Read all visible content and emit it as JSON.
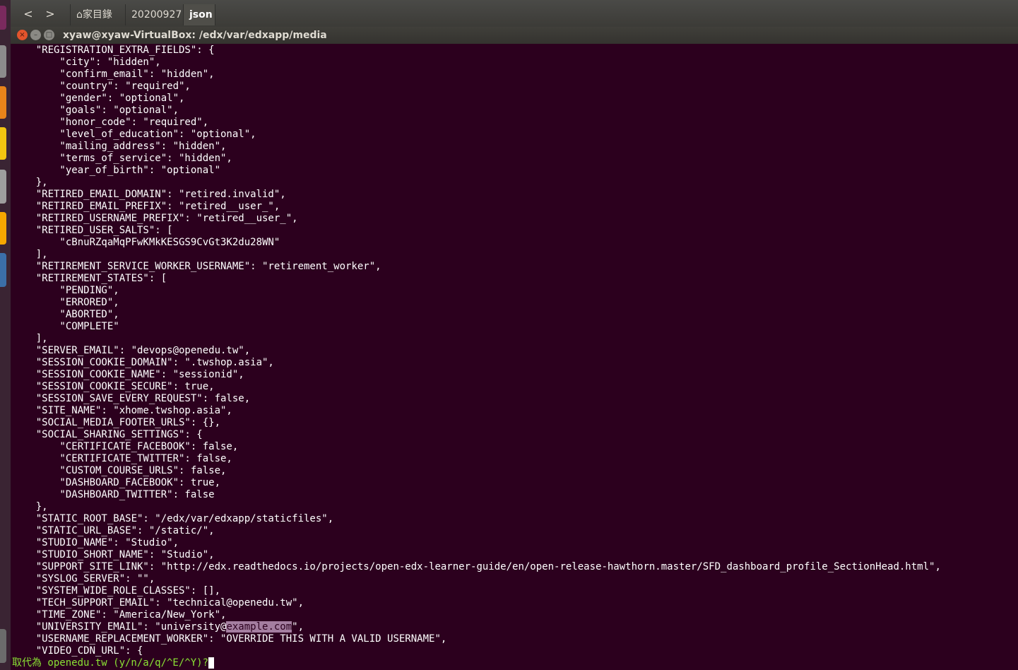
{
  "topbar": {
    "back_label": "<",
    "forward_label": ">",
    "home_label": "家目錄",
    "crumb_1": "20200927",
    "crumb_2": "json"
  },
  "window": {
    "title": "xyaw@xyaw-VirtualBox: /edx/var/edxapp/media",
    "close_label": "×",
    "minimize_label": "–",
    "maximize_label": "□"
  },
  "terminal": {
    "lines": [
      "    \"REGISTRATION_EXTRA_FIELDS\": {",
      "        \"city\": \"hidden\",",
      "        \"confirm_email\": \"hidden\",",
      "        \"country\": \"required\",",
      "        \"gender\": \"optional\",",
      "        \"goals\": \"optional\",",
      "        \"honor_code\": \"required\",",
      "        \"level_of_education\": \"optional\",",
      "        \"mailing_address\": \"hidden\",",
      "        \"terms_of_service\": \"hidden\",",
      "        \"year_of_birth\": \"optional\"",
      "    },",
      "    \"RETIRED_EMAIL_DOMAIN\": \"retired.invalid\",",
      "    \"RETIRED_EMAIL_PREFIX\": \"retired__user_\",",
      "    \"RETIRED_USERNAME_PREFIX\": \"retired__user_\",",
      "    \"RETIRED_USER_SALTS\": [",
      "        \"cBnuRZqaMqPFwKMkKESGS9CvGt3K2du28WN\"",
      "    ],",
      "    \"RETIREMENT_SERVICE_WORKER_USERNAME\": \"retirement_worker\",",
      "    \"RETIREMENT_STATES\": [",
      "        \"PENDING\",",
      "        \"ERRORED\",",
      "        \"ABORTED\",",
      "        \"COMPLETE\"",
      "    ],",
      "    \"SERVER_EMAIL\": \"devops@openedu.tw\",",
      "    \"SESSION_COOKIE_DOMAIN\": \".twshop.asia\",",
      "    \"SESSION_COOKIE_NAME\": \"sessionid\",",
      "    \"SESSION_COOKIE_SECURE\": true,",
      "    \"SESSION_SAVE_EVERY_REQUEST\": false,",
      "    \"SITE_NAME\": \"xhome.twshop.asia\",",
      "    \"SOCIAL_MEDIA_FOOTER_URLS\": {},",
      "    \"SOCIAL_SHARING_SETTINGS\": {",
      "        \"CERTIFICATE_FACEBOOK\": false,",
      "        \"CERTIFICATE_TWITTER\": false,",
      "        \"CUSTOM_COURSE_URLS\": false,",
      "        \"DASHBOARD_FACEBOOK\": true,",
      "        \"DASHBOARD_TWITTER\": false",
      "    },",
      "    \"STATIC_ROOT_BASE\": \"/edx/var/edxapp/staticfiles\",",
      "    \"STATIC_URL_BASE\": \"/static/\",",
      "    \"STUDIO_NAME\": \"Studio\",",
      "    \"STUDIO_SHORT_NAME\": \"Studio\",",
      "    \"SUPPORT_SITE_LINK\": \"http://edx.readthedocs.io/projects/open-edx-learner-guide/en/open-release-hawthorn.master/SFD_dashboard_profile_SectionHead.html\",",
      "    \"SYSLOG_SERVER\": \"\",",
      "    \"SYSTEM_WIDE_ROLE_CLASSES\": [],",
      "    \"TECH_SUPPORT_EMAIL\": \"technical@openedu.tw\",",
      "    \"TIME_ZONE\": \"America/New_York\","
    ],
    "highlight_line": {
      "before": "    \"UNIVERSITY_EMAIL\": \"university@",
      "match": "example.com",
      "after": "\","
    },
    "after_lines": [
      "    \"USERNAME_REPLACEMENT_WORKER\": \"OVERRIDE THIS WITH A VALID USERNAME\",",
      "    \"VIDEO_CDN_URL\": {"
    ],
    "prompt": "取代為 openedu.tw (y/n/a/q/^E/^Y)?"
  },
  "colors": {
    "terminal_bg": "#2c001e",
    "prompt_green": "#8ae234",
    "match_highlight": "#a47ea0",
    "close_button": "#e2542c"
  }
}
